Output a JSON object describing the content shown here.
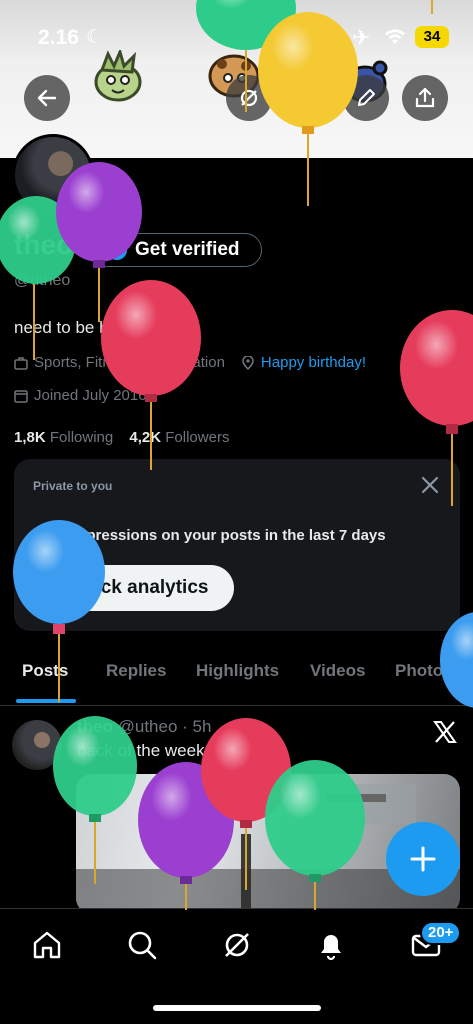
{
  "status_bar": {
    "time": "2.16",
    "battery": "34"
  },
  "profile": {
    "name": "theo",
    "handle": "@utheo",
    "bio": "need to be hugged 24/7",
    "category": "Sports, Fitness & Recreation",
    "birthday": "Happy birthday!",
    "joined": "Joined July 2016",
    "following_count": "1,8K",
    "following_label": "Following",
    "followers_count": "4,2K",
    "followers_label": "Followers",
    "verify_button": "Get verified"
  },
  "private_card": {
    "kicker": "Private to you",
    "text": "1,8K impressions on your posts in the last 7 days",
    "button": "Unlock analytics"
  },
  "tabs": [
    "Posts",
    "Replies",
    "Highlights",
    "Videos",
    "Photos"
  ],
  "post": {
    "author": "theo",
    "handle": "@utheo",
    "time": "· 5h",
    "text": "back of the week"
  },
  "nav": {
    "messages_badge": "20+"
  },
  "colors": {
    "accent": "#1d9bf0",
    "background": "#000000",
    "balloon_green": "#2ecc8a",
    "balloon_purple": "#9b3fd1",
    "balloon_red": "#e63c5c",
    "balloon_yellow": "#f4c932",
    "balloon_blue": "#3b9cf0"
  },
  "icons": {
    "back": "arrow-left-icon",
    "premium": "grok-icon",
    "search": "search-icon",
    "edit": "pencil-icon",
    "share": "share-icon"
  }
}
